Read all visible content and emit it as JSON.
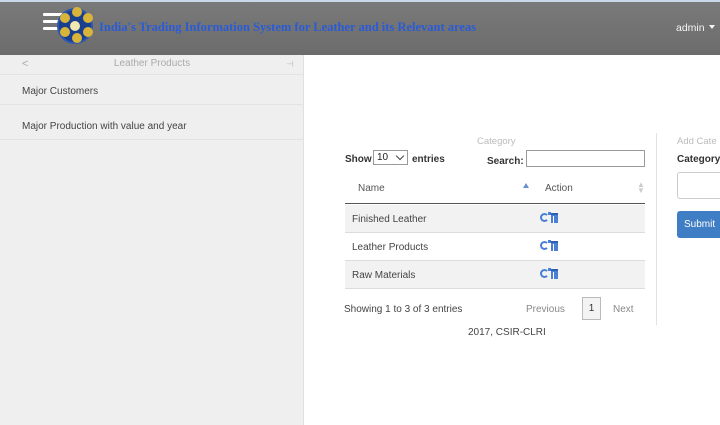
{
  "navbar": {
    "title": "India's Trading Information System for Leather and its Relevant areas",
    "user_menu_label": "admin"
  },
  "sidebar": {
    "header_title": "Leather Products",
    "back_glyph": "<",
    "pin_glyph": "⊣",
    "items": [
      {
        "label": "Major Customers"
      },
      {
        "label": "Major Production with value and year"
      }
    ]
  },
  "category_panel": {
    "title": "Category",
    "show_label": "Show",
    "page_length": "10",
    "entries_label": "entries",
    "search_label": "Search:",
    "search_value": "",
    "columns": [
      "Name",
      "Action"
    ],
    "rows": [
      {
        "name": "Finished Leather"
      },
      {
        "name": "Leather Products"
      },
      {
        "name": "Raw Materials"
      }
    ],
    "info": "Showing 1 to 3 of 3 entries",
    "pagination": {
      "previous": "Previous",
      "current": "1",
      "next": "Next"
    },
    "footer": "2017, CSIR-CLRI"
  },
  "add_panel": {
    "title": "Add Cate",
    "field_label": "Category",
    "field_value": "",
    "submit_label": "Submit"
  },
  "colors": {
    "navbar_bg": "#737373",
    "brand_text": "#2a5bd7",
    "sidebar_bg": "#efefef",
    "primary_button": "#3f7dc4",
    "icon_blue": "#4a7fd6"
  },
  "icons": {
    "menu": "hamburger-icon",
    "logo": "emblem-logo",
    "edit": "edit-icon",
    "delete": "trash-icon",
    "dropdown": "caret-down-icon"
  }
}
